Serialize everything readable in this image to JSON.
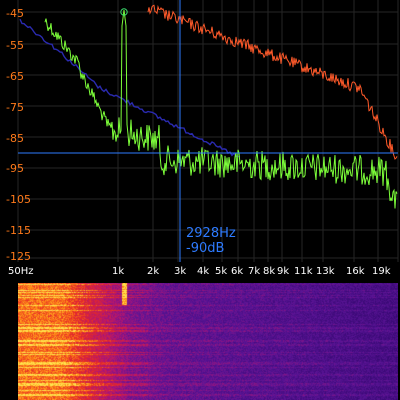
{
  "spectrum": {
    "y_ticks": [
      "-45",
      "-55",
      "-65",
      "-75",
      "-85",
      "-95",
      "-105",
      "-115",
      "-125"
    ],
    "x_ticks": [
      "50Hz",
      "1k",
      "2k",
      "3k",
      "4k",
      "5k",
      "6k",
      "7k",
      "8k",
      "9k",
      "11k",
      "13k",
      "16k",
      "19k"
    ],
    "cursor": {
      "frequency": "2928Hz",
      "level": "-90dB"
    },
    "colors": {
      "background": "#000000",
      "grid": "#2a2a2a",
      "y_label": "#ff7a1a",
      "x_label": "#ffffff",
      "cursor": "#2e7bff",
      "live_trace": "#7dff3a",
      "peak_trace": "#ff5a2a",
      "average_trace": "#2a2ab0",
      "peak_marker": "#39d96b"
    },
    "icons": {
      "peak_marker": "circle-marker-icon"
    }
  }
}
